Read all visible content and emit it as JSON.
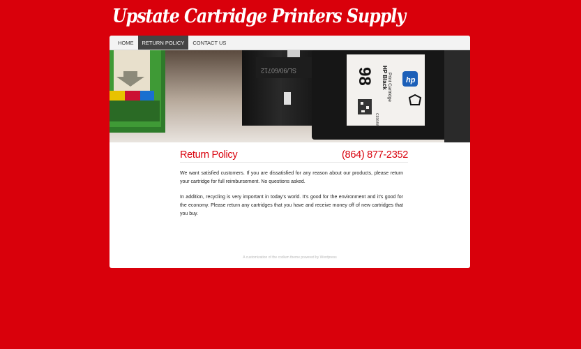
{
  "site": {
    "title": "Upstate Cartridge Printers Supply"
  },
  "nav": {
    "items": [
      {
        "label": "HOME"
      },
      {
        "label": "RETURN POLICY",
        "active": true
      },
      {
        "label": "CONTACT US"
      }
    ]
  },
  "page": {
    "title": "Return Policy",
    "phone": "(864) 877-2352",
    "paragraphs": [
      "We want satisfied customers.  If you are dissatisfied for any reason about our products, please return your cartridge for full reimbursement. No questions asked.",
      "In addition, recycling is very important in today’s world. It’s good for the environment and it’s good for the economy. Please return any cartridges that you have and receive money off of new cartridges that you buy."
    ]
  },
  "footer": {
    "text": "A customization of the codium theme powered by Wordpress"
  },
  "banner": {
    "cartridge_label_number": "98",
    "cartridge_label_brand": "HP Black",
    "cartridge_label_type": "Print Cartridge",
    "cartridge_label_code": "C9364W",
    "cartridge_mid_code": "SL/90/60712"
  },
  "colors": {
    "accent": "#d9000b",
    "nav_active": "#444444"
  }
}
